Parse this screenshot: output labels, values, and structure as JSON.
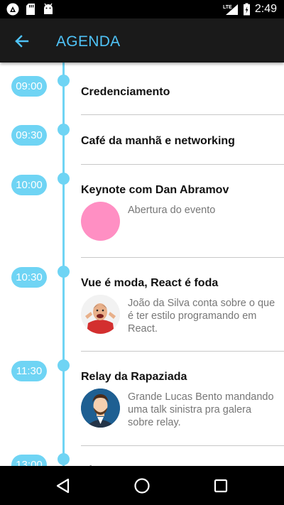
{
  "status_bar": {
    "time": "2:49",
    "network": "LTE",
    "icons": [
      "react-native-icon",
      "sd-card-icon",
      "android-icon",
      "lte-signal-icon",
      "battery-icon"
    ]
  },
  "app_bar": {
    "title": "AGENDA",
    "back_icon": "arrow-left-icon"
  },
  "colors": {
    "accent": "#6fd4f4",
    "title": "#4fc3f7",
    "app_bar": "#1a1a1a",
    "avatar_pink": "#ff8fc3"
  },
  "agenda": [
    {
      "time": "09:00",
      "title": "Credenciamento"
    },
    {
      "time": "09:30",
      "title": "Café da manhã e networking"
    },
    {
      "time": "10:00",
      "title": "Keynote com Dan Abramov",
      "description": "Abertura do evento",
      "avatar": "pink-circle"
    },
    {
      "time": "10:30",
      "title": "Vue é moda, React é foda",
      "description": "João da Silva conta sobre o que é ter estilo programando em React.",
      "avatar": "person-photo"
    },
    {
      "time": "11:30",
      "title": "Relay da Rapaziada",
      "description": "Grande Lucas Bento mandando uma talk sinistra pra galera sobre relay.",
      "avatar": "person-illustration"
    },
    {
      "time": "13:00",
      "title": "Al"
    }
  ],
  "nav_bar": {
    "buttons": [
      "back-triangle-icon",
      "home-circle-icon",
      "recents-square-icon"
    ]
  }
}
